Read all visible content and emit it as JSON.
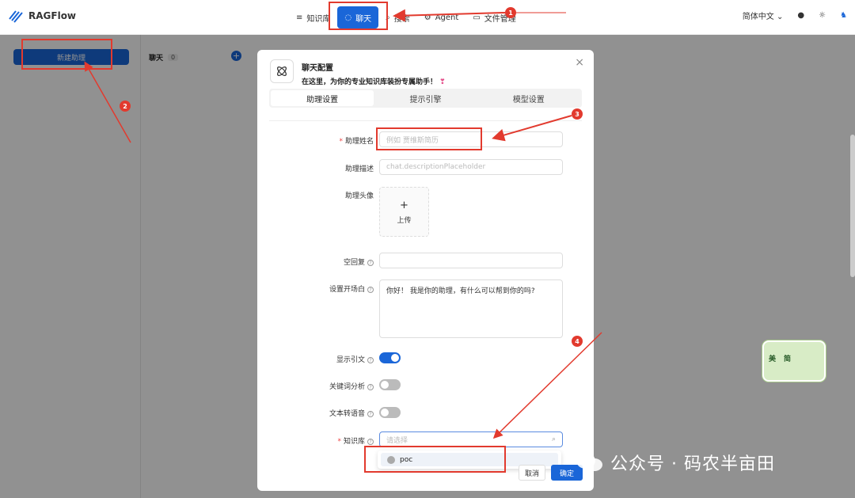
{
  "app": {
    "name": "RAGFlow"
  },
  "nav": [
    {
      "label": "知识库",
      "icon": "database-icon"
    },
    {
      "label": "聊天",
      "icon": "chat-icon",
      "active": true
    },
    {
      "label": "搜索",
      "icon": "search-icon"
    },
    {
      "label": "Agent",
      "icon": "agent-icon"
    },
    {
      "label": "文件管理",
      "icon": "file-icon"
    }
  ],
  "topright": {
    "language": "简体中文"
  },
  "sidebar": {
    "new_assistant": "新建助理"
  },
  "chat_list": {
    "title": "聊天",
    "count": "0"
  },
  "modal": {
    "title": "聊天配置",
    "subtitle": "在这里，为你的专业知识库装扮专属助手！",
    "tabs": [
      "助理设置",
      "提示引擎",
      "模型设置"
    ],
    "fields": {
      "name_label": "助理姓名",
      "name_placeholder": "例如 贾维斯简历",
      "desc_label": "助理描述",
      "desc_placeholder": "chat.descriptionPlaceholder",
      "avatar_label": "助理头像",
      "upload_label": "上传",
      "empty_reply_label": "空回复",
      "opener_label": "设置开场白",
      "opener_value": "你好！ 我是你的助理，有什么可以帮到你的吗?",
      "show_quote_label": "显示引文",
      "keyword_label": "关键词分析",
      "tts_label": "文本转语音",
      "kb_label": "知识库",
      "kb_placeholder": "请选择"
    },
    "dropdown_option": "poc",
    "cancel": "取消",
    "ok": "确定"
  },
  "annotations": [
    "1",
    "2",
    "3",
    "4"
  ],
  "sticker": {
    "left": "美",
    "right": "简"
  },
  "watermark": "公众号 · 码农半亩田",
  "colors": {
    "accent": "#1a66d8",
    "annotation": "#e23a2e"
  }
}
